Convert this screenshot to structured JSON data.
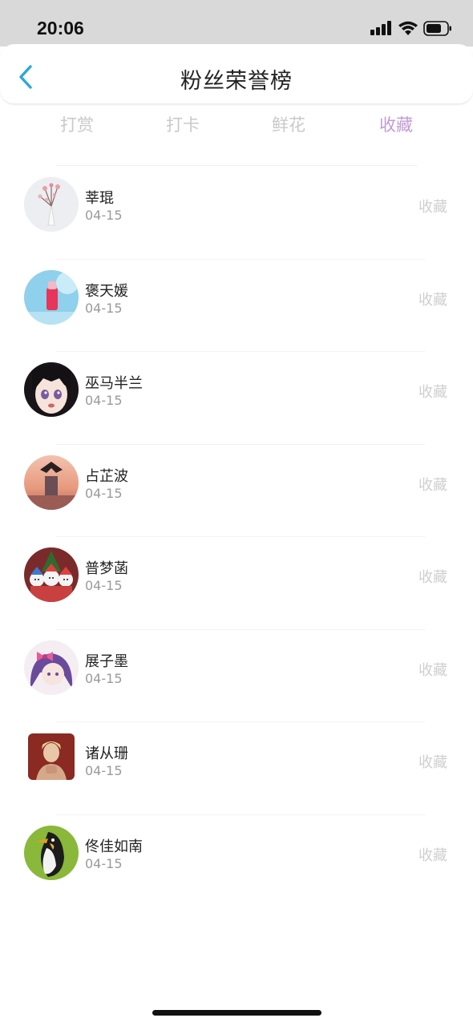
{
  "status": {
    "time": "20:06",
    "icons": [
      "signal-icon",
      "wifi-icon",
      "battery-icon"
    ]
  },
  "header": {
    "title": "粉丝荣誉榜",
    "back_icon": "chevron-left-icon"
  },
  "colors": {
    "accent": "#29a8e0",
    "tab_active": "#c39bd6",
    "tab_inactive": "#c9c9c9",
    "status_bar": "#d9d9d9"
  },
  "tabs": [
    {
      "label": "打赏",
      "active": false
    },
    {
      "label": "打卡",
      "active": false
    },
    {
      "label": "鲜花",
      "active": false
    },
    {
      "label": "收藏",
      "active": true
    }
  ],
  "fans": [
    {
      "name": "莘琨",
      "date": "04-15",
      "action": "收藏"
    },
    {
      "name": "褒天媛",
      "date": "04-15",
      "action": "收藏"
    },
    {
      "name": "巫马半兰",
      "date": "04-15",
      "action": "收藏"
    },
    {
      "name": "占芷波",
      "date": "04-15",
      "action": "收藏"
    },
    {
      "name": "普梦菡",
      "date": "04-15",
      "action": "收藏"
    },
    {
      "name": "展子墨",
      "date": "04-15",
      "action": "收藏"
    },
    {
      "name": "诸从珊",
      "date": "04-15",
      "action": "收藏"
    },
    {
      "name": "佟佳如南",
      "date": "04-15",
      "action": "收藏"
    }
  ]
}
